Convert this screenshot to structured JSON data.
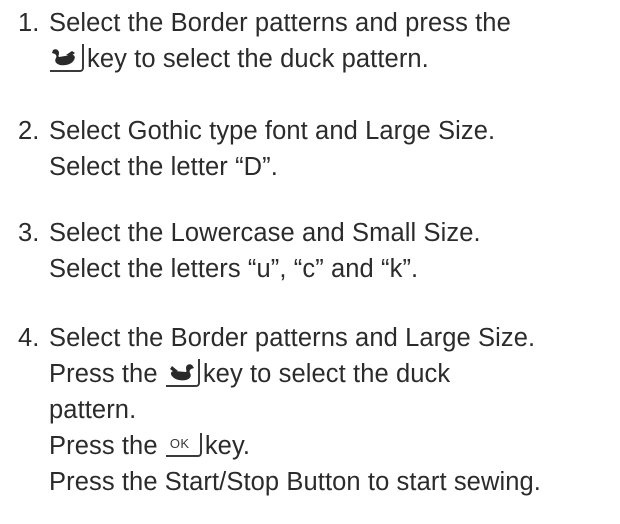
{
  "steps": [
    {
      "number": "1.",
      "line1": "Select the Border patterns and press the",
      "line2_after_key": "key to select the duck pattern.",
      "key_icon": "duck-left-icon"
    },
    {
      "number": "2.",
      "line1": "Select Gothic type font and Large Size.",
      "line2": "Select the letter “D”."
    },
    {
      "number": "3.",
      "line1": "Select the Lowercase and Small Size.",
      "line2": "Select the letters “u”, “c” and “k”."
    },
    {
      "number": "4.",
      "line1": "Select the Border patterns and Large Size.",
      "line2_before_key": "Press the",
      "line2_after_key": "key to select the duck",
      "line3": "pattern.",
      "line4_before_key": "Press the",
      "ok_key_label": "OK",
      "line4_after_key": "key.",
      "line5": "Press the Start/Stop Button to start sewing.",
      "key_icon": "duck-right-icon"
    }
  ],
  "colors": {
    "text": "#2b2b2b",
    "key_border": "#3a3a3a",
    "duck": "#2a2a2a"
  }
}
